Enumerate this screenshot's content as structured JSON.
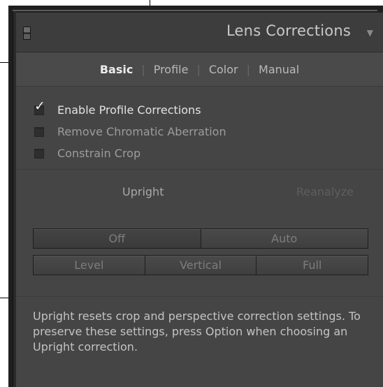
{
  "panel": {
    "title": "Lens Corrections",
    "collapse_icon": "triangle-down-icon"
  },
  "tabs": [
    {
      "label": "Basic",
      "active": true
    },
    {
      "label": "Profile",
      "active": false
    },
    {
      "label": "Color",
      "active": false
    },
    {
      "label": "Manual",
      "active": false
    }
  ],
  "options": [
    {
      "label": "Enable Profile Corrections",
      "checked": true
    },
    {
      "label": "Remove Chromatic Aberration",
      "checked": false
    },
    {
      "label": "Constrain Crop",
      "checked": false
    }
  ],
  "upright": {
    "label": "Upright",
    "reanalyze_label": "Reanalyze",
    "row1": [
      "Off",
      "Auto"
    ],
    "row2": [
      "Level",
      "Vertical",
      "Full"
    ]
  },
  "help_text": "Upright resets crop and perspective correction settings. To preserve these settings, press Option when choosing an Upright correction.",
  "colors": {
    "panel_bg": "#454545",
    "header_bg": "#3d3d3d",
    "text_active": "#ececec",
    "text_disabled": "#5e5e5e"
  }
}
